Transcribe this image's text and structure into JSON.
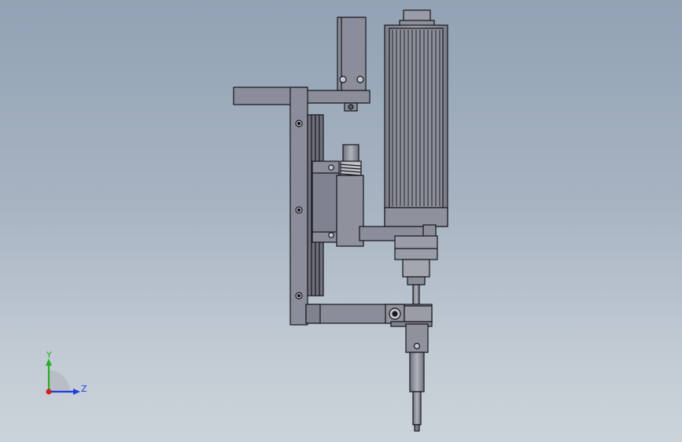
{
  "triad": {
    "y_label": "Y",
    "z_label": "Z",
    "colors": {
      "y": "#22b022",
      "z": "#1f3fd6",
      "x": "#d42020"
    }
  },
  "colors": {
    "background_top": "#92a2b4",
    "background_bottom": "#cbd3da",
    "part_fill": "#8b8d9a",
    "part_light": "#a9abb6",
    "part_dark": "#5c5e6a",
    "edge": "#16161c"
  }
}
